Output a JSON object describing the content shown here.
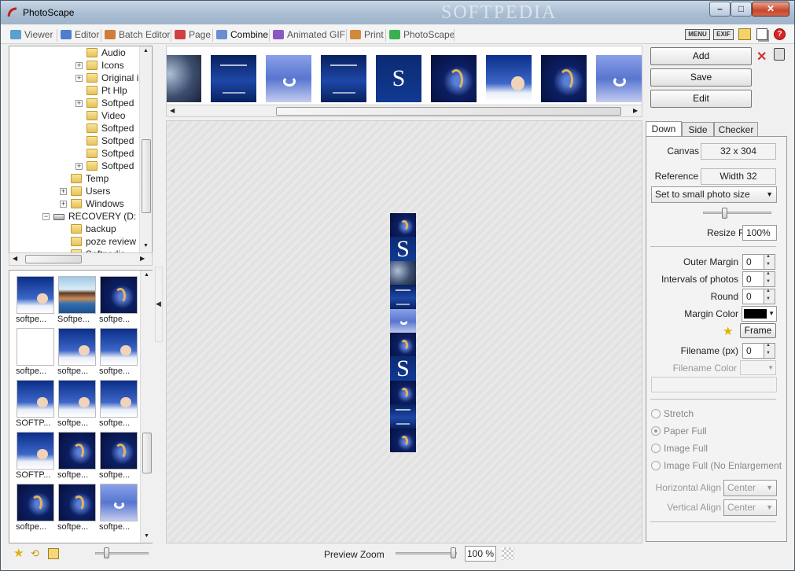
{
  "window": {
    "title": "PhotoScape",
    "watermark": "SOFTPEDIA"
  },
  "tabs": [
    {
      "label": "Viewer",
      "color": "#5aa0d0"
    },
    {
      "label": "Editor",
      "color": "#4d7fd0"
    },
    {
      "label": "Batch Editor",
      "color": "#d07c3a"
    },
    {
      "label": "Page",
      "color": "#d04040"
    },
    {
      "label": "Combine",
      "color": "#6a8ed0"
    },
    {
      "label": "Animated GIF",
      "color": "#8a58c0"
    },
    {
      "label": "Print",
      "color": "#d08a3a"
    },
    {
      "label": "PhotoScape",
      "color": "#3ab050"
    }
  ],
  "toolbar_icons": {
    "menu": "MENU",
    "exif": "EXIF"
  },
  "tree": {
    "items": [
      {
        "label": "Audio",
        "level": 3,
        "expander": ""
      },
      {
        "label": "Icons",
        "level": 3,
        "expander": "+"
      },
      {
        "label": "Original i",
        "level": 3,
        "expander": "+"
      },
      {
        "label": "Pt Hlp",
        "level": 3,
        "expander": ""
      },
      {
        "label": "Softped",
        "level": 3,
        "expander": "+"
      },
      {
        "label": "Video",
        "level": 3,
        "expander": ""
      },
      {
        "label": "Softped",
        "level": 3,
        "expander": ""
      },
      {
        "label": "Softped",
        "level": 3,
        "expander": ""
      },
      {
        "label": "Softped",
        "level": 3,
        "expander": ""
      },
      {
        "label": "Softped",
        "level": 3,
        "expander": "+"
      },
      {
        "label": "Temp",
        "level": 2,
        "expander": ""
      },
      {
        "label": "Users",
        "level": 2,
        "expander": "+"
      },
      {
        "label": "Windows",
        "level": 2,
        "expander": "+"
      },
      {
        "label": "RECOVERY (D:",
        "level": 1,
        "expander": "-"
      },
      {
        "label": "backup",
        "level": 2,
        "expander": ""
      },
      {
        "label": "poze review",
        "level": 2,
        "expander": ""
      },
      {
        "label": "Softpedia",
        "level": 2,
        "expander": ""
      }
    ]
  },
  "files": [
    {
      "caption": "softpe...",
      "kind": "woman"
    },
    {
      "caption": "Softpe...",
      "kind": "beach"
    },
    {
      "caption": "softpe...",
      "kind": "swirl"
    },
    {
      "caption": "softpe...",
      "kind": "blank"
    },
    {
      "caption": "softpe...",
      "kind": "woman"
    },
    {
      "caption": "softpe...",
      "kind": "woman"
    },
    {
      "caption": "SOFTP...",
      "kind": "woman"
    },
    {
      "caption": "softpe...",
      "kind": "woman"
    },
    {
      "caption": "softpe...",
      "kind": "woman"
    },
    {
      "caption": "SOFTP...",
      "kind": "woman"
    },
    {
      "caption": "softpe...",
      "kind": "swirl"
    },
    {
      "caption": "softpe...",
      "kind": "swirl"
    },
    {
      "caption": "softpe...",
      "kind": "swirl"
    },
    {
      "caption": "softpe...",
      "kind": "swirl"
    },
    {
      "caption": "softpe...",
      "kind": "moon"
    }
  ],
  "strip": [
    {
      "kind": "logo"
    },
    {
      "kind": "poster"
    },
    {
      "kind": "moon"
    },
    {
      "kind": "poster"
    },
    {
      "kind": "s"
    },
    {
      "kind": "swirl"
    },
    {
      "kind": "woman"
    },
    {
      "kind": "swirl"
    },
    {
      "kind": "moon"
    }
  ],
  "column_cells": [
    "swirl",
    "s",
    "logo",
    "poster",
    "moon",
    "swirl",
    "s",
    "swirl",
    "poster",
    "swirl"
  ],
  "right": {
    "add_label": "Add",
    "save_label": "Save",
    "edit_label": "Edit",
    "tabs": [
      "Down",
      "Side",
      "Checker"
    ],
    "canvas_label": "Canvas",
    "canvas_value": "32 x 304",
    "reference_label": "Reference",
    "reference_value": "Width 32",
    "size_select": "Set to small photo size",
    "resize_label": "Resize Ratio",
    "resize_value": "100%",
    "outer_margin_label": "Outer Margin",
    "outer_margin_value": "0",
    "intervals_label": "Intervals of photos",
    "intervals_value": "0",
    "round_label": "Round",
    "round_value": "0",
    "margin_color_label": "Margin Color",
    "margin_color": "#000000",
    "frame_label": "Frame",
    "filename_label": "Filename (px)",
    "filename_value": "0",
    "filename_color_label": "Filename Color",
    "radios": [
      "Stretch",
      "Paper Full",
      "Image Full",
      "Image Full (No Enlargement)"
    ],
    "selected_radio": 1,
    "h_align_label": "Horizontal Align",
    "h_align_value": "Center",
    "v_align_label": "Vertical Align",
    "v_align_value": "Center"
  },
  "bottom": {
    "zoom_label": "Preview Zoom",
    "zoom_value": "100 %"
  }
}
